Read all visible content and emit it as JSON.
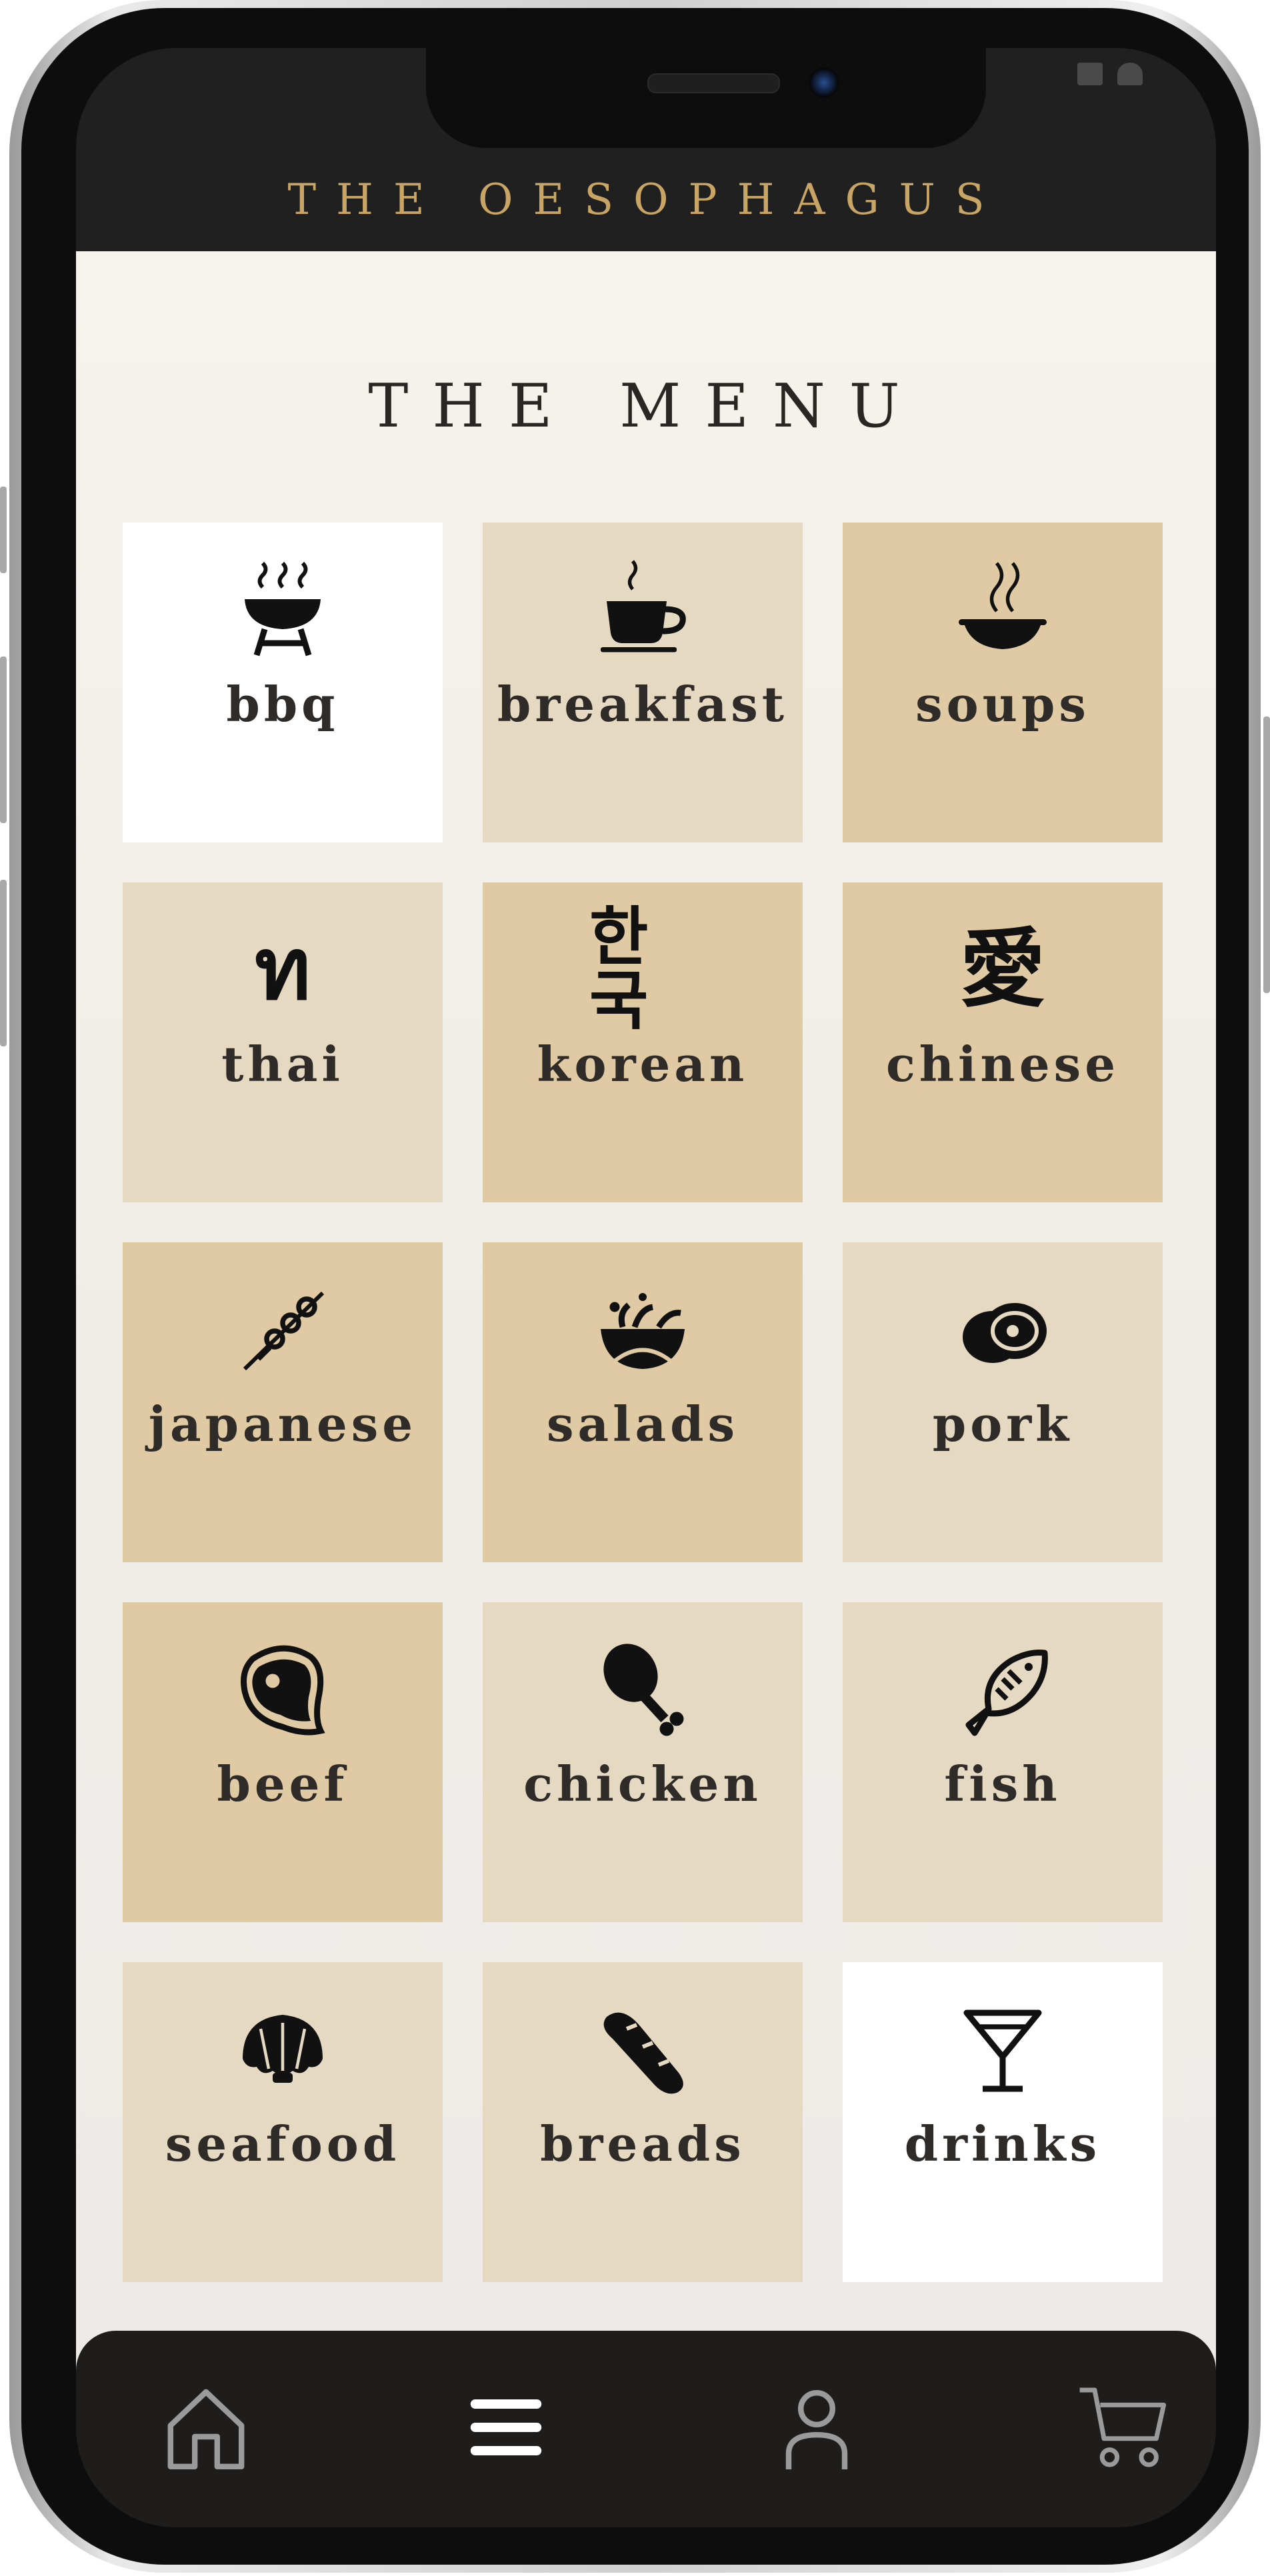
{
  "app": {
    "brand": "THE OESOPHAGUS"
  },
  "page": {
    "title": "THE MENU"
  },
  "colors": {
    "tile_white": "#ffffff",
    "tile_light": "#e6d9c2",
    "tile_tan": "#e0caa3",
    "accent": "#c9a565",
    "bar": "#1e1d1c"
  },
  "categories": [
    {
      "label": "bbq",
      "icon": "grill-icon",
      "tone": "tile_white"
    },
    {
      "label": "breakfast",
      "icon": "coffee-cup-icon",
      "tone": "tile_light"
    },
    {
      "label": "soups",
      "icon": "soup-bowl-icon",
      "tone": "tile_tan"
    },
    {
      "label": "thai",
      "icon": "thai-letter-icon",
      "glyph": "ท",
      "tone": "tile_light"
    },
    {
      "label": "korean",
      "icon": "hangul-icon",
      "glyph": "한국",
      "tone": "tile_tan"
    },
    {
      "label": "chinese",
      "icon": "chinese-character-icon",
      "glyph": "愛",
      "tone": "tile_tan"
    },
    {
      "label": "japanese",
      "icon": "skewer-icon",
      "tone": "tile_tan"
    },
    {
      "label": "salads",
      "icon": "salad-bowl-icon",
      "tone": "tile_tan"
    },
    {
      "label": "pork",
      "icon": "ham-icon",
      "tone": "tile_light"
    },
    {
      "label": "beef",
      "icon": "steak-icon",
      "tone": "tile_tan"
    },
    {
      "label": "chicken",
      "icon": "drumstick-icon",
      "tone": "tile_light"
    },
    {
      "label": "fish",
      "icon": "fish-icon",
      "tone": "tile_light"
    },
    {
      "label": "seafood",
      "icon": "shell-icon",
      "tone": "tile_light"
    },
    {
      "label": "breads",
      "icon": "baguette-icon",
      "tone": "tile_light"
    },
    {
      "label": "drinks",
      "icon": "cocktail-icon",
      "tone": "tile_white"
    }
  ],
  "bottom_nav": [
    {
      "name": "home",
      "icon": "home-icon"
    },
    {
      "name": "menu",
      "icon": "hamburger-menu-icon"
    },
    {
      "name": "account",
      "icon": "user-icon"
    },
    {
      "name": "cart",
      "icon": "cart-icon"
    }
  ]
}
